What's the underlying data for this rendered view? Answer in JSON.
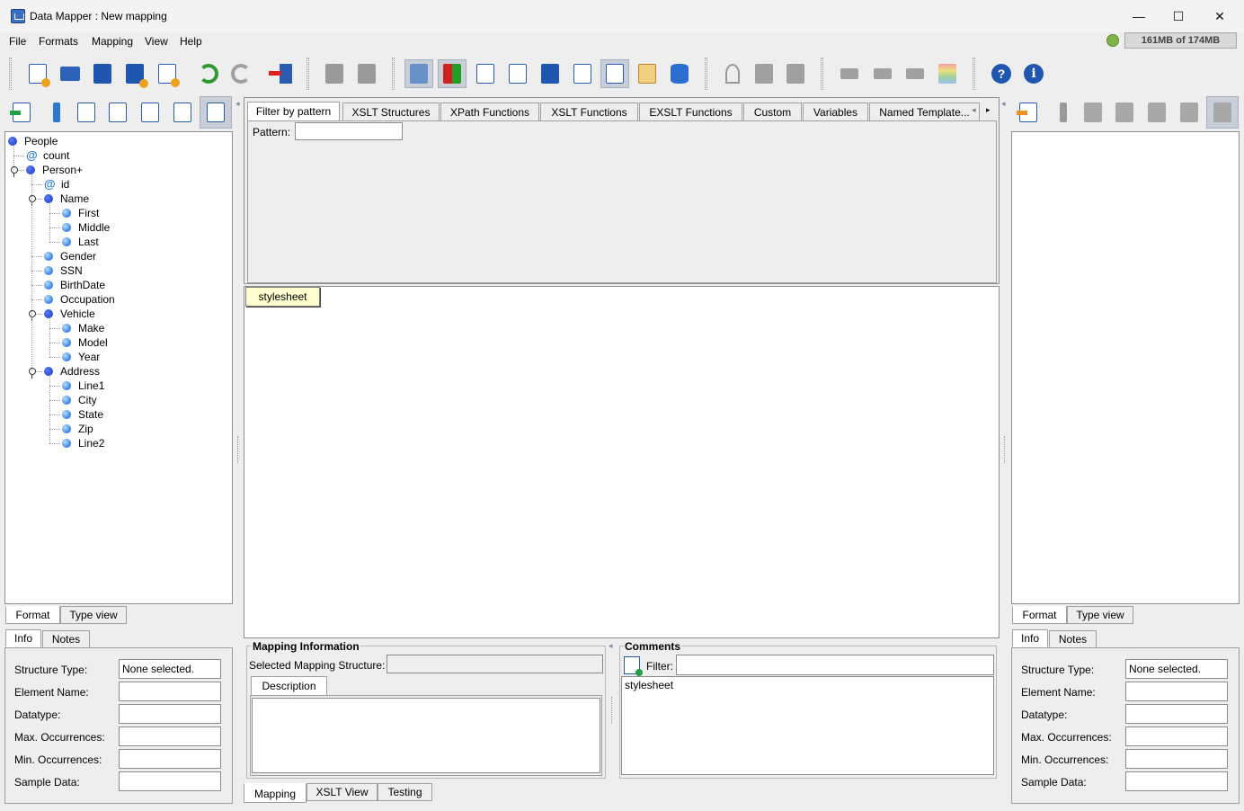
{
  "window": {
    "title": "Data Mapper : New mapping",
    "minimize": "—",
    "maximize": "☐",
    "close": "✕"
  },
  "menu": [
    "File",
    "Formats",
    "Mapping",
    "View",
    "Help"
  ],
  "memory": "161MB of 174MB",
  "source_tree": [
    {
      "label": "People",
      "kind": "root",
      "level": 0,
      "expand": false
    },
    {
      "label": "count",
      "kind": "attr",
      "level": 1,
      "expand": false
    },
    {
      "label": "Person+",
      "kind": "element",
      "level": 1,
      "expand": true
    },
    {
      "label": "id",
      "kind": "attr",
      "level": 2,
      "expand": false
    },
    {
      "label": "Name",
      "kind": "element",
      "level": 2,
      "expand": true
    },
    {
      "label": "First",
      "kind": "leaf",
      "level": 3,
      "expand": false
    },
    {
      "label": "Middle",
      "kind": "leaf",
      "level": 3,
      "expand": false
    },
    {
      "label": "Last",
      "kind": "leaf",
      "level": 3,
      "expand": false
    },
    {
      "label": "Gender",
      "kind": "leaf",
      "level": 2,
      "expand": false
    },
    {
      "label": "SSN",
      "kind": "leaf",
      "level": 2,
      "expand": false
    },
    {
      "label": "BirthDate",
      "kind": "leaf",
      "level": 2,
      "expand": false
    },
    {
      "label": "Occupation",
      "kind": "leaf",
      "level": 2,
      "expand": false
    },
    {
      "label": "Vehicle",
      "kind": "element",
      "level": 2,
      "expand": true
    },
    {
      "label": "Make",
      "kind": "leaf",
      "level": 3,
      "expand": false
    },
    {
      "label": "Model",
      "kind": "leaf",
      "level": 3,
      "expand": false
    },
    {
      "label": "Year",
      "kind": "leaf",
      "level": 3,
      "expand": false
    },
    {
      "label": "Address",
      "kind": "element",
      "level": 2,
      "expand": true
    },
    {
      "label": "Line1",
      "kind": "leaf",
      "level": 3,
      "expand": false
    },
    {
      "label": "City",
      "kind": "leaf",
      "level": 3,
      "expand": false
    },
    {
      "label": "State",
      "kind": "leaf",
      "level": 3,
      "expand": false
    },
    {
      "label": "Zip",
      "kind": "leaf",
      "level": 3,
      "expand": false
    },
    {
      "label": "Line2",
      "kind": "leaf",
      "level": 3,
      "expand": false
    }
  ],
  "view_tabs": {
    "format": "Format",
    "type_view": "Type view"
  },
  "info_tabs": {
    "info": "Info",
    "notes": "Notes"
  },
  "info_fields": {
    "structure_type": "Structure Type:",
    "element_name": "Element Name:",
    "datatype": "Datatype:",
    "max_occ": "Max. Occurrences:",
    "min_occ": "Min. Occurrences:",
    "sample_data": "Sample Data:",
    "structure_value": "None selected."
  },
  "palette_tabs": [
    "Filter by pattern",
    "XSLT Structures",
    "XPath Functions",
    "XSLT Functions",
    "EXSLT Functions",
    "Custom",
    "Variables",
    "Named Template..."
  ],
  "pattern_label": "Pattern:",
  "pattern_value": "",
  "stylesheet_node": "stylesheet",
  "mapping_info": {
    "title": "Mapping Information",
    "selected_label": "Selected Mapping Structure:",
    "selected_value": "",
    "description_tab": "Description"
  },
  "comments": {
    "title": "Comments",
    "filter_label": "Filter:",
    "filter_value": "",
    "items": [
      "stylesheet"
    ]
  },
  "center_tabs": [
    "Mapping",
    "XSLT View",
    "Testing"
  ],
  "arrows": {
    "left": "◂",
    "right": "▸"
  }
}
